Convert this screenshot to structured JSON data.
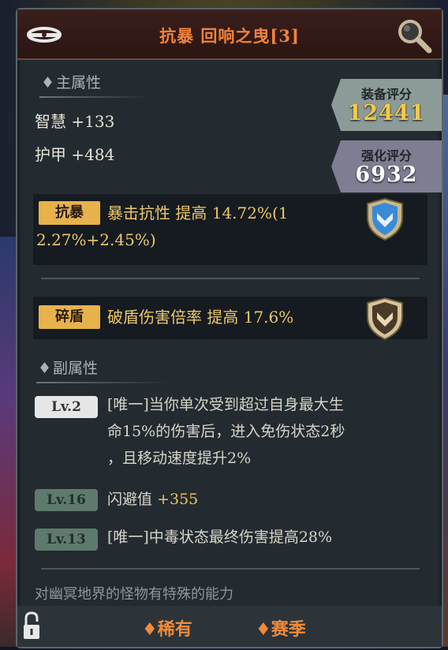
{
  "item": {
    "title": "抗暴 回响之曳[3]"
  },
  "main_attrs": {
    "label": "主属性",
    "stats": [
      {
        "name": "智慧",
        "value": "+133"
      },
      {
        "name": "护甲",
        "value": "+484"
      }
    ]
  },
  "scores": {
    "equip_label": "装备评分",
    "equip_value": "12441",
    "enh_label": "强化评分",
    "enh_value": "6932"
  },
  "special_attrs": [
    {
      "badge": "抗暴",
      "line1": "暴击抗性 提高 14.72%(1",
      "line2": "2.27%+2.45%)",
      "icon": "blue-shield-icon"
    },
    {
      "badge": "碎盾",
      "line1": "破盾伤害倍率 提高 17.6%",
      "icon": "bronze-shield-icon"
    }
  ],
  "sub_attrs": {
    "label": "副属性",
    "items": [
      {
        "lv": "Lv.2",
        "lines": [
          "[唯一]当你单次受到超过自身最大生",
          "命15%的伤害后，进入免伤状态2秒",
          "，且移动速度提升2%"
        ]
      },
      {
        "lv": "Lv.16",
        "name": "闪避值",
        "value": "+355"
      },
      {
        "lv": "Lv.13",
        "text": "[唯一]中毒状态最终伤害提高28%"
      }
    ]
  },
  "lore": "对幽冥地界的怪物有特殊的能力",
  "footer_tags": [
    "稀有",
    "赛季"
  ],
  "colors": {
    "accent": "#f0823a",
    "gold": "#e7b24b",
    "panel": "#232b31"
  }
}
